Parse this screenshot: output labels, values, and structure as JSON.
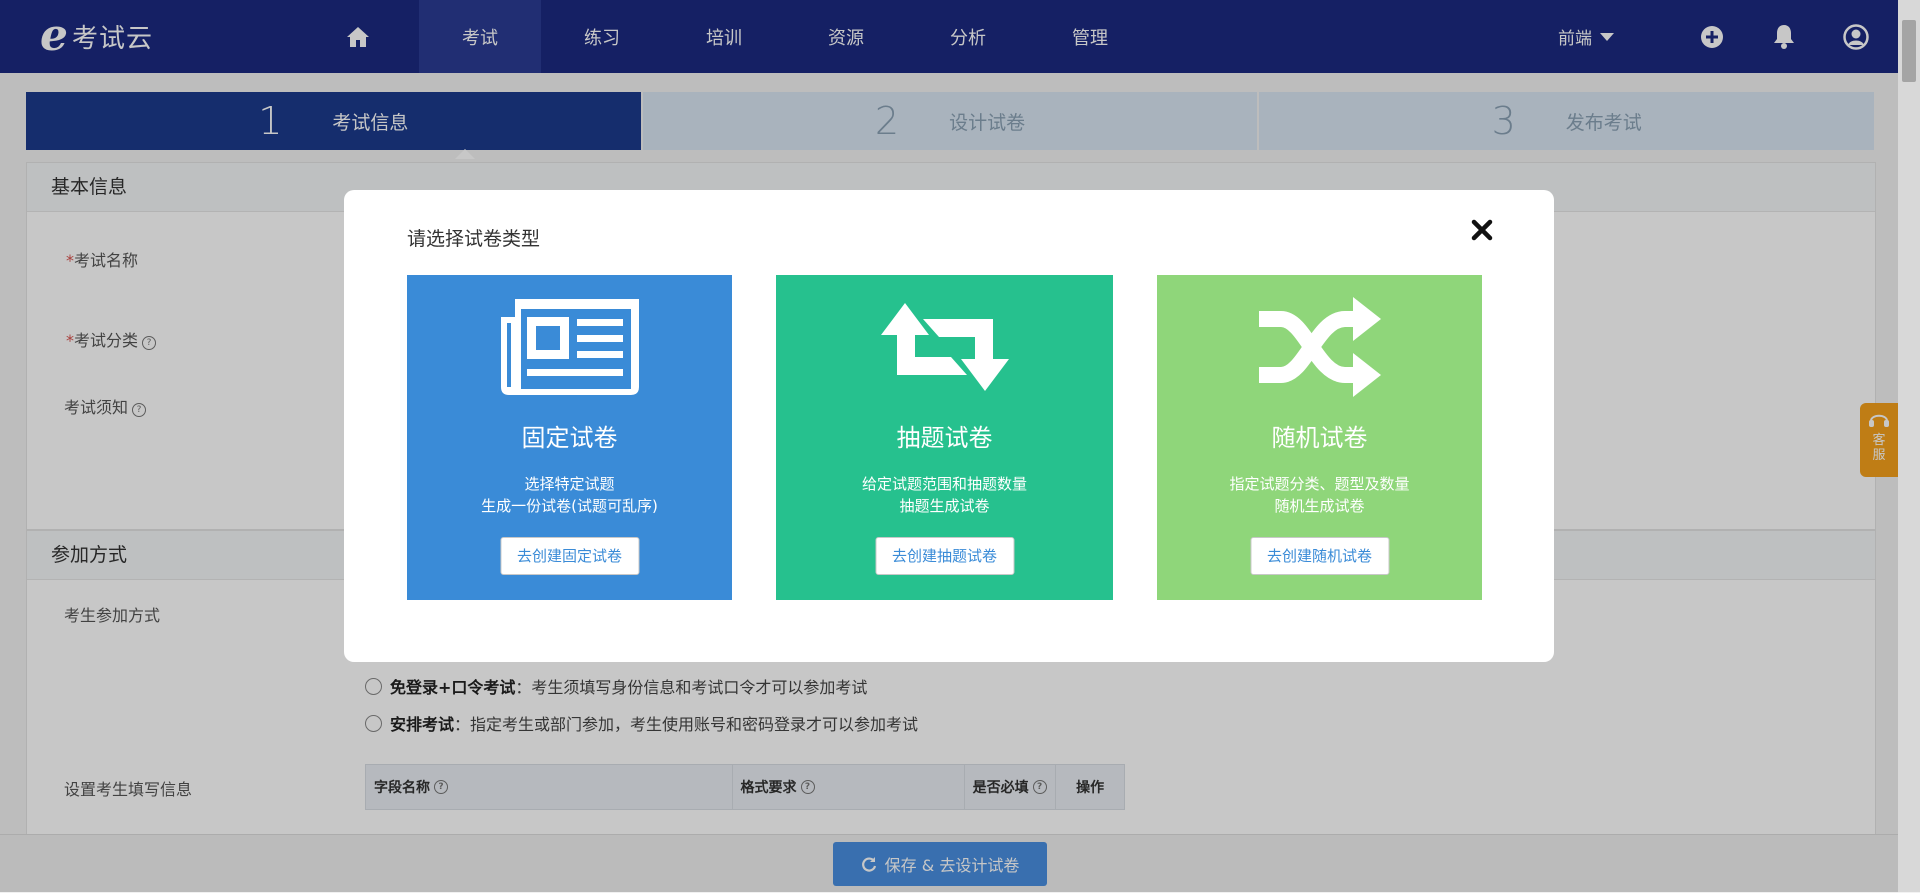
{
  "header": {
    "logo_mark": "e",
    "logo_text": "考试云",
    "nav": [
      {
        "label": ""
      },
      {
        "label": "考试"
      },
      {
        "label": "练习"
      },
      {
        "label": "培训"
      },
      {
        "label": "资源"
      },
      {
        "label": "分析"
      },
      {
        "label": "管理"
      }
    ],
    "mode_label": "前端",
    "icons": [
      "home-icon",
      "plus-circle-icon",
      "bell-icon",
      "user-icon"
    ]
  },
  "steps": [
    {
      "num": "1",
      "label": "考试信息"
    },
    {
      "num": "2",
      "label": "设计试卷"
    },
    {
      "num": "3",
      "label": "发布考试"
    }
  ],
  "basic": {
    "title": "基本信息",
    "name_label": "考试名称",
    "category_label": "考试分类",
    "notice_label": "考试须知",
    "required_mark": "*"
  },
  "join": {
    "title": "参加方式",
    "mode_label": "考生参加方式",
    "options": [
      {
        "bold": "免登录+口令考试",
        "text": "：考生须填写身份信息和考试口令才可以参加考试"
      },
      {
        "bold": "安排考试",
        "text": "：指定考生或部门参加，考生使用账号和密码登录才可以参加考试"
      }
    ],
    "info_label": "设置考生填写信息",
    "table_headers": [
      "字段名称",
      "格式要求",
      "是否必填",
      "操作"
    ]
  },
  "save_button": "保存 & 去设计试卷",
  "side_service": "客服",
  "modal": {
    "title": "请选择试卷类型",
    "cards": [
      {
        "title": "固定试卷",
        "desc1": "选择特定试题",
        "desc2": "生成一份试卷(试题可乱序)",
        "button": "去创建固定试卷",
        "color": "#3a8bd7",
        "icon": "newspaper-icon"
      },
      {
        "title": "抽题试卷",
        "desc1": "给定试题范围和抽题数量",
        "desc2": "抽题生成试卷",
        "button": "去创建抽题试卷",
        "color": "#26c18e",
        "icon": "retweet-icon"
      },
      {
        "title": "随机试卷",
        "desc1": "指定试题分类、题型及数量",
        "desc2": "随机生成试卷",
        "button": "去创建随机试卷",
        "color": "#8fd67a",
        "icon": "shuffle-icon"
      }
    ]
  }
}
